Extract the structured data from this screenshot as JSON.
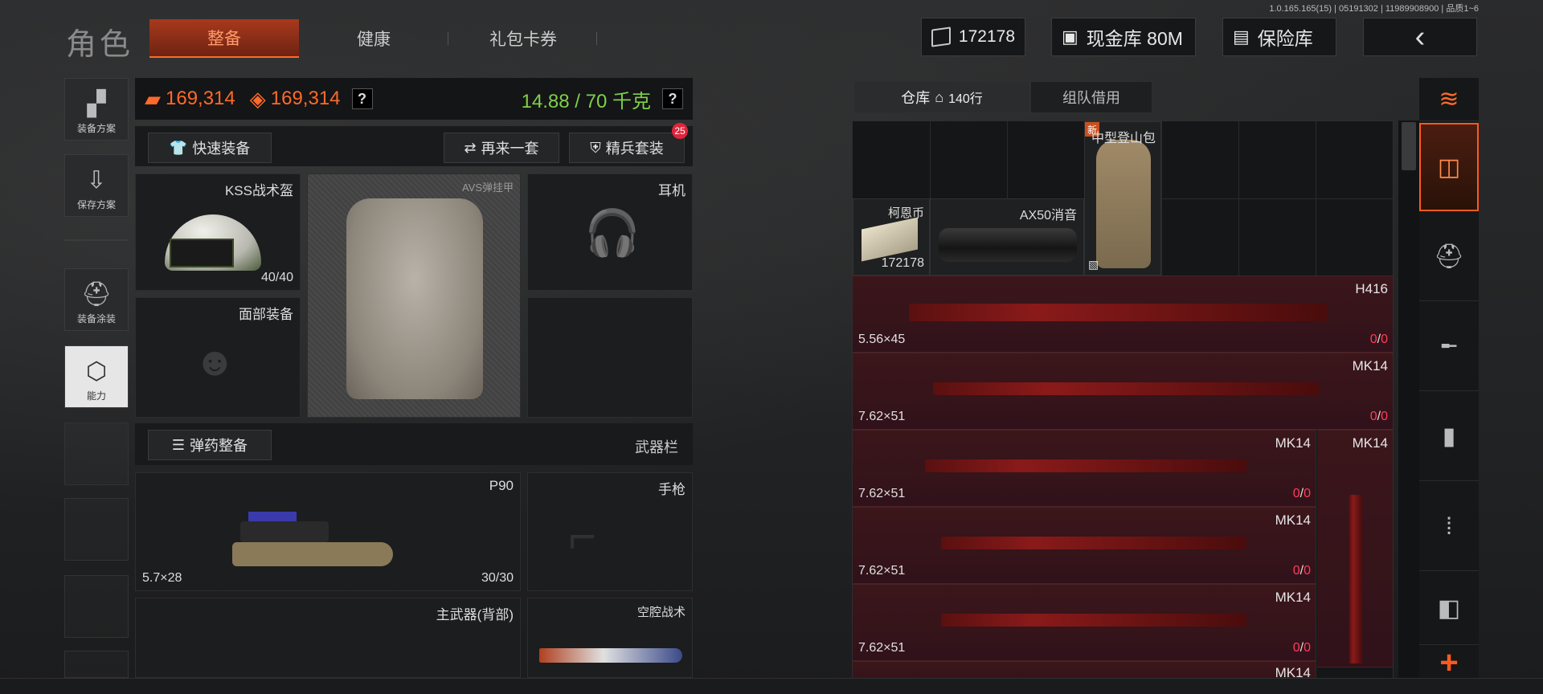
{
  "version_text": "1.0.165.165(15) | 05191302 | 11989908900 | 品质1~6",
  "header": {
    "title": "角色",
    "tabs": [
      {
        "label": "整备",
        "active": true
      },
      {
        "label": "健康",
        "active": false
      },
      {
        "label": "礼包卡券",
        "active": false
      }
    ],
    "currency_value": "172178",
    "cash_vault_label": "现金库 80M",
    "insurance_label": "保险库",
    "back_glyph": "‹"
  },
  "sidebar": {
    "items": [
      {
        "label": "装备方案",
        "icon": "armor-icon"
      },
      {
        "label": "保存方案",
        "icon": "download-icon"
      },
      {
        "label": "装备涂装",
        "icon": "paint-helmet-icon"
      },
      {
        "label": "能力",
        "icon": "ability-icon",
        "highlighted": true
      }
    ]
  },
  "stats": {
    "armor_value": "169,314",
    "bag_value": "169,314",
    "weight": "14.88 / 70 千克",
    "help_glyph": "?"
  },
  "actions": {
    "quick_equip": "快速装备",
    "reroll": "再来一套",
    "elite_set": "精兵套装",
    "elite_badge": "25"
  },
  "slots": {
    "helmet": {
      "label": "KSS战术盔",
      "durability": "40/40"
    },
    "vest": {
      "label": "AVS弹挂甲"
    },
    "earphone": {
      "label": "耳机"
    },
    "face": {
      "label": "面部装备"
    },
    "ammo_equip": "弹药整备",
    "weapon_bar": "武器栏",
    "primary": {
      "label": "P90",
      "caliber": "5.7×28",
      "ammo": "30/30"
    },
    "pistol": {
      "label": "手枪"
    },
    "back_weapon": {
      "label": "主武器(背部)"
    },
    "melee": {
      "label": "空腔战术"
    }
  },
  "warehouse": {
    "tab_warehouse": "仓库",
    "rows": "140行",
    "tab_team": "组队借用",
    "items": [
      {
        "name": "柯恩币",
        "qty": "172178"
      },
      {
        "name": "AX50消音"
      },
      {
        "name": "中型登山包",
        "badge": "新"
      }
    ],
    "guns": [
      {
        "name": "H416",
        "caliber": "5.56×45",
        "count_a": "0",
        "count_b": "0"
      },
      {
        "name": "MK14",
        "caliber": "7.62×51",
        "count_a": "0",
        "count_b": "0"
      },
      {
        "name": "MK14",
        "caliber": "7.62×51",
        "count_a": "0",
        "count_b": "0"
      },
      {
        "name": "MK14",
        "caliber": "7.62×51",
        "count_a": "0",
        "count_b": "0"
      },
      {
        "name": "MK14",
        "caliber": "7.62×51",
        "count_a": "0",
        "count_b": "0"
      },
      {
        "name": "MK14"
      }
    ],
    "side_gun": {
      "name": "MK14"
    }
  },
  "filter_icons": [
    "stack-all-icon",
    "stack-icon",
    "helmet-icon",
    "rifle-icon",
    "magazine-icon",
    "ammo-icon",
    "scope-icon",
    "add-icon"
  ]
}
